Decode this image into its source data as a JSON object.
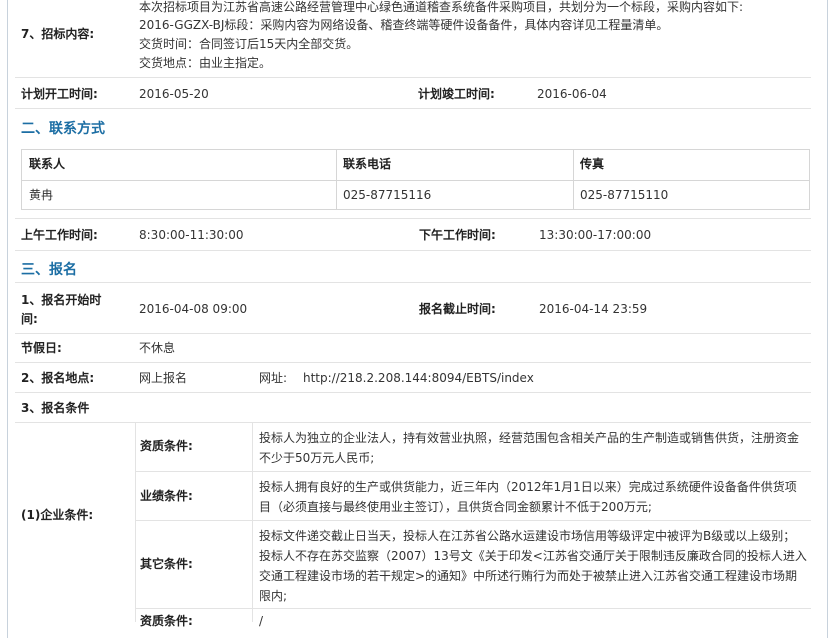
{
  "item7": {
    "label": "7、招标内容:",
    "lines": [
      "本次招标项目为江苏省高速公路经营管理中心绿色通道稽查系统备件采购项目，共划分为一个标段，采购内容如下:",
      "2016-GGZX-BJ标段：采购内容为网络设备、稽查终端等硬件设备备件，具体内容详见工程量清单。",
      "交货时间：合同签订后15天内全部交货。",
      "交货地点：由业主指定。"
    ]
  },
  "schedule": {
    "start_label": "计划开工时间:",
    "start_value": "2016-05-20",
    "end_label": "计划竣工时间:",
    "end_value": "2016-06-04"
  },
  "contact": {
    "section_title": "二、联系方式",
    "headers": [
      "联系人",
      "联系电话",
      "传真"
    ],
    "row": [
      "黄冉",
      "025-87715116",
      "025-87715110"
    ],
    "am_label": "上午工作时间:",
    "am_value": "8:30:00-11:30:00",
    "pm_label": "下午工作时间:",
    "pm_value": "13:30:00-17:00:00"
  },
  "registration": {
    "section_title": "三、报名",
    "start_label_line1": "1、报名开始时",
    "start_label_line2": "间:",
    "start_value": "2016-04-08 09:00",
    "end_label": "报名截止时间:",
    "end_value": "2016-04-14 23:59",
    "holiday_label": "节假日:",
    "holiday_value": "不休息",
    "place_label": "2、报名地点:",
    "place_value": "网上报名",
    "url_label": "网址:",
    "url": "http://218.2.208.144:8094/EBTS/index",
    "cond_label": "3、报名条件",
    "enterprise_label": "(1)企业条件:",
    "qual_label": "资质条件:",
    "qual_text": "投标人为独立的企业法人，持有效营业执照，经营范围包含相关产品的生产制造或销售供货，注册资金不少于50万元人民币;",
    "perf_label": "业绩条件:",
    "perf_text": "投标人拥有良好的生产或供货能力，近三年内（2012年1月1日以来）完成过系统硬件设备备件供货项目（必须直接与最终使用业主签订），且供货合同金额累计不低于200万元;",
    "other_label": "其它条件:",
    "other_text": "投标文件递交截止日当天，投标人在江苏省公路水运建设市场信用等级评定中被评为B级或以上级别；投标人不存在苏交监察（2007）13号文《关于印发<江苏省交通厅关于限制违反廉政合同的投标人进入交通工程建设市场的若干规定>的通知》中所述行贿行为而处于被禁止进入江苏省交通工程建设市场期限内;",
    "next_label": "资质条件:",
    "next_value": "/"
  }
}
